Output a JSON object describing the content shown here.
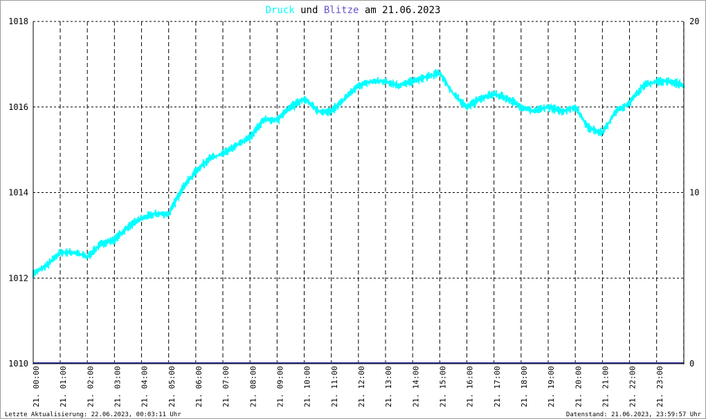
{
  "title": {
    "word1": "Druck",
    "word2": "und",
    "word3": "Blitze",
    "word4": "am 21.06.2023"
  },
  "footer": {
    "left": "Letzte Aktualisierung: 22.06.2023, 00:03:11 Uhr",
    "right": "Datenstand: 21.06.2023, 23:59:57 Uhr"
  },
  "colors": {
    "pressure": "#00ffff",
    "lightning": "#3333aa",
    "axis": "#000000",
    "grid": "#000000",
    "background": "#ffffff"
  },
  "chart_data": {
    "type": "line",
    "grid": true,
    "y_left": {
      "ylim": [
        1010,
        1018
      ],
      "ticks": [
        1010,
        1012,
        1014,
        1016,
        1018
      ],
      "labels": [
        "1010",
        "1012",
        "1014",
        "1016",
        "1018"
      ]
    },
    "y_right": {
      "ylim": [
        0,
        20
      ],
      "ticks": [
        0,
        10,
        20
      ],
      "labels": [
        "0",
        "10",
        "20"
      ]
    },
    "x": {
      "xlim": [
        0,
        24
      ],
      "ticks": [
        0,
        1,
        2,
        3,
        4,
        5,
        6,
        7,
        8,
        9,
        10,
        11,
        12,
        13,
        14,
        15,
        16,
        17,
        18,
        19,
        20,
        21,
        22,
        23
      ],
      "labels": [
        "21. 00:00",
        "21. 01:00",
        "21. 02:00",
        "21. 03:00",
        "21. 04:00",
        "21. 05:00",
        "21. 06:00",
        "21. 07:00",
        "21. 08:00",
        "21. 09:00",
        "21. 10:00",
        "21. 11:00",
        "21. 12:00",
        "21. 13:00",
        "21. 14:00",
        "21. 15:00",
        "21. 16:00",
        "21. 17:00",
        "21. 18:00",
        "21. 19:00",
        "21. 20:00",
        "21. 21:00",
        "21. 22:00",
        "21. 23:00"
      ]
    },
    "series": [
      {
        "name": "Druck",
        "axis": "left",
        "x": [
          0,
          0.5,
          1,
          1.5,
          2,
          2.5,
          3,
          3.5,
          4,
          4.5,
          5,
          5.5,
          6,
          6.5,
          7,
          7.5,
          8,
          8.5,
          9,
          9.5,
          10,
          10.5,
          11,
          11.5,
          12,
          12.5,
          13,
          13.5,
          14,
          14.5,
          15,
          15.5,
          16,
          16.5,
          17,
          17.5,
          18,
          18.5,
          19,
          19.5,
          20,
          20.5,
          21,
          21.5,
          22,
          22.5,
          23,
          23.5,
          24
        ],
        "y": [
          1012.1,
          1012.3,
          1012.6,
          1012.6,
          1012.5,
          1012.8,
          1012.9,
          1013.2,
          1013.4,
          1013.5,
          1013.5,
          1014.1,
          1014.5,
          1014.8,
          1014.9,
          1015.1,
          1015.3,
          1015.7,
          1015.7,
          1016.0,
          1016.2,
          1015.9,
          1015.9,
          1016.2,
          1016.5,
          1016.6,
          1016.6,
          1016.5,
          1016.6,
          1016.7,
          1016.8,
          1016.3,
          1016.0,
          1016.2,
          1016.3,
          1016.2,
          1016.0,
          1015.9,
          1016.0,
          1015.9,
          1016.0,
          1015.5,
          1015.4,
          1015.9,
          1016.1,
          1016.5,
          1016.6,
          1016.6,
          1016.5
        ]
      },
      {
        "name": "Blitze",
        "axis": "right",
        "x": [
          0,
          24
        ],
        "y": [
          0,
          0
        ]
      }
    ]
  }
}
